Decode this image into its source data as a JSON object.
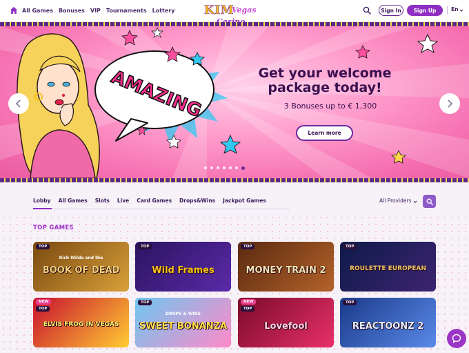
{
  "nav": {
    "items": [
      "All Games",
      "Bonuses",
      "VIP",
      "Tournaments",
      "Lottery"
    ]
  },
  "logo": {
    "line1": "KIM",
    "line2": "Vegas",
    "line3": "Casino"
  },
  "auth": {
    "signin": "Sign In",
    "signup": "Sign Up"
  },
  "language": "En",
  "hero": {
    "title_line1": "Get your welcome",
    "title_line2": "package today!",
    "subtitle": "3 Bonuses up to € 1,300",
    "button": "Learn more",
    "bubble_text": "AMAZING",
    "slides_count": 7,
    "active_slide": 6
  },
  "tabs": {
    "items": [
      "Lobby",
      "All Games",
      "Slots",
      "Live",
      "Card Games",
      "Drops&Wins",
      "Jackpot Games"
    ],
    "active": "Lobby",
    "providers_label": "All Providers"
  },
  "section": {
    "title": "TOP GAMES"
  },
  "games": [
    {
      "badge": "TOP",
      "new": false,
      "title": "BOOK OF DEAD",
      "pre": "Rich Wilde and the",
      "bg": "#7a4a10",
      "bg2": "#d9a03a",
      "color": "#f3d27a"
    },
    {
      "badge": "TOP",
      "new": false,
      "title": "Wild Frames",
      "pre": "",
      "bg": "#2a1460",
      "bg2": "#5b2aa8",
      "color": "#f6c21a"
    },
    {
      "badge": "TOP",
      "new": false,
      "title": "MONEY TRAIN 2",
      "pre": "",
      "bg": "#5a2a10",
      "bg2": "#b4622a",
      "color": "#f1e2b0"
    },
    {
      "badge": "TOP",
      "new": false,
      "title": "ROULETTE EUROPEAN",
      "pre": "",
      "bg": "#0e1a4a",
      "bg2": "#3d2470",
      "color": "#e8c46a"
    },
    {
      "badge": "TOP",
      "new": true,
      "title": "ELVIS FROG IN VEGAS",
      "pre": "",
      "bg": "#c8102e",
      "bg2": "#ffcc33",
      "color": "#fff46a"
    },
    {
      "badge": "TOP",
      "new": false,
      "title": "SWEET BONANZA",
      "pre": "DROPS & WINS",
      "bg": "#6ec6f0",
      "bg2": "#ff8ac8",
      "color": "#ffe04a"
    },
    {
      "badge": "TOP",
      "new": true,
      "title": "Lovefool",
      "pre": "",
      "bg": "#7a0a2a",
      "bg2": "#e8306a",
      "color": "#ffd0e0"
    },
    {
      "badge": "TOP",
      "new": false,
      "title": "REACTOONZ 2",
      "pre": "",
      "bg": "#1a3a8a",
      "bg2": "#5a8ae8",
      "color": "#e6f0ff"
    }
  ],
  "colors": {
    "accent": "#8e2ec2",
    "heroPink": "#f56eb0",
    "textDark": "#3a1050"
  },
  "icons": [
    "home-icon",
    "search-icon",
    "chevron-down-icon",
    "arrow-left-icon",
    "arrow-right-icon",
    "chat-icon"
  ]
}
